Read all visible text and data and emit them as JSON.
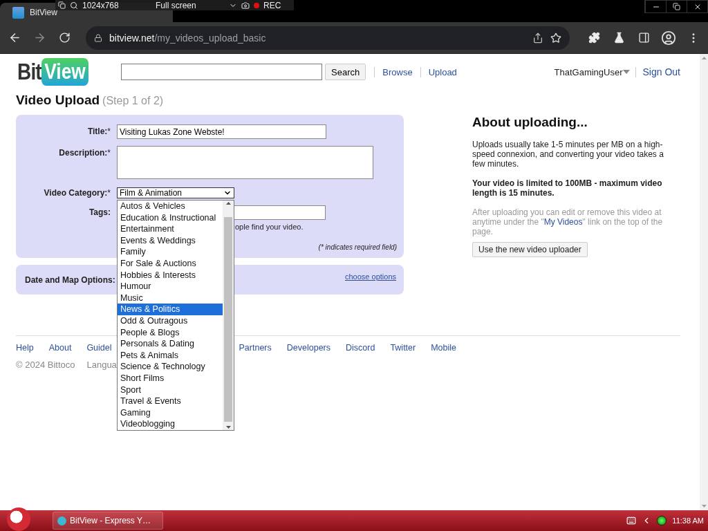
{
  "browser": {
    "tab_title": "BitView",
    "url_host": "bitview.net",
    "url_path": "/my_videos_upload_basic"
  },
  "recorder": {
    "resolution": "1024x768",
    "mode": "Full screen",
    "rec": "REC"
  },
  "site": {
    "logo_left": "Bit",
    "logo_right": "View",
    "search_button": "Search",
    "nav": [
      "Browse",
      "Upload"
    ],
    "user": "ThatGamingUser",
    "sign_out": "Sign Out"
  },
  "page": {
    "title": "Video Upload",
    "step": "(Step 1 of 2)"
  },
  "form": {
    "fields": [
      {
        "kind": "text",
        "label": "Title:",
        "mark": "*",
        "value": "Visiting Lukas Zone Webste!"
      },
      {
        "kind": "textarea",
        "label": "Description:",
        "mark": "*"
      },
      {
        "kind": "select",
        "label": "Video Category:",
        "mark": "*",
        "value": "Film & Animation"
      },
      {
        "kind": "partial",
        "label": "Tags:"
      }
    ],
    "hint": "ople find your video.",
    "required_note": "(* indicates required field)"
  },
  "date_options": {
    "label": "Date and Map Options:",
    "link": "choose options"
  },
  "dropdown": {
    "options": [
      {
        "label": "Autos & Vehicles",
        "selected": false
      },
      {
        "label": "Education & Instructional",
        "selected": false
      },
      {
        "label": "Entertainment",
        "selected": false
      },
      {
        "label": "Events & Weddings",
        "selected": false
      },
      {
        "label": "Family",
        "selected": false
      },
      {
        "label": "For Sale & Auctions",
        "selected": false
      },
      {
        "label": "Hobbies & Interests",
        "selected": false
      },
      {
        "label": "Humour",
        "selected": false
      },
      {
        "label": "Music",
        "selected": false
      },
      {
        "label": "News & Politics",
        "selected": true
      },
      {
        "label": "Odd & Outragous",
        "selected": false
      },
      {
        "label": "People & Blogs",
        "selected": false
      },
      {
        "label": "Personals & Dating",
        "selected": false
      },
      {
        "label": "Pets & Animals",
        "selected": false
      },
      {
        "label": "Science & Technology",
        "selected": false
      },
      {
        "label": "Short Films",
        "selected": false
      },
      {
        "label": "Sport",
        "selected": false
      },
      {
        "label": "Travel & Events",
        "selected": false
      },
      {
        "label": "Gaming",
        "selected": false
      },
      {
        "label": "Videoblogging",
        "selected": false
      }
    ]
  },
  "about": {
    "title": "About uploading...",
    "text": "Uploads usually take 1-5 minutes per MB on a high-speed connexion, and converting your video takes a few minutes.",
    "limit": "Your video is limited to 100MB - maximum video length is 15 minutes.",
    "note_before": "After uploading you can edit or remove this video at anytime under the \"",
    "note_link": "My Videos",
    "note_after": "\" link on the top of the page.",
    "button": "Use the new video uploader"
  },
  "footer": {
    "links_left": [
      "Help",
      "About",
      "Guidel"
    ],
    "links_right": [
      "Partners",
      "Developers",
      "Discord",
      "Twitter",
      "Mobile"
    ],
    "copyright": "© 2024 Bittoco",
    "language": "Langua"
  },
  "taskbar": {
    "task": "BitView - Express Y…",
    "time": "11:38 AM"
  }
}
